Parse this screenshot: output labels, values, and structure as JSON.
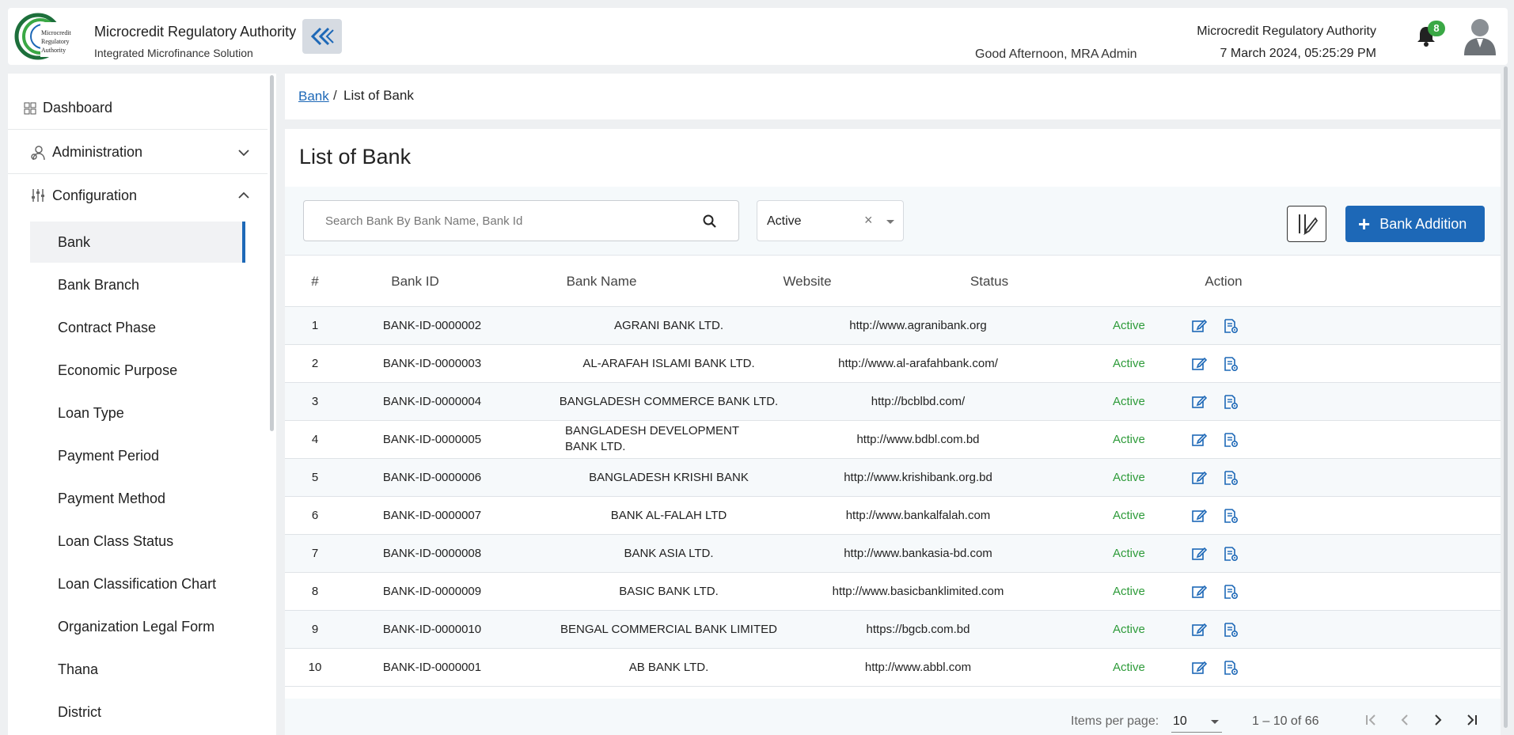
{
  "header": {
    "org_name": "Microcredit Regulatory Authority",
    "org_subtitle": "Integrated Microfinance Solution",
    "logo_text": "Microcredit Regulatory Authority",
    "greeting": "Good Afternoon, MRA Admin",
    "right_org_name": "Microcredit Regulatory Authority",
    "datetime": "7 March 2024, 05:25:29 PM",
    "notification_count": "8",
    "brand_green": "#3aa845",
    "brand_blue": "#1d68b7"
  },
  "sidebar": {
    "dashboard": "Dashboard",
    "administration": "Administration",
    "configuration": "Configuration",
    "config_items": [
      "Bank",
      "Bank Branch",
      "Contract Phase",
      "Economic Purpose",
      "Loan Type",
      "Payment Period",
      "Payment Method",
      "Loan Class Status",
      "Loan Classification Chart",
      "Organization Legal Form",
      "Thana",
      "District"
    ],
    "active_item": "Bank"
  },
  "breadcrumb": {
    "link": "Bank",
    "separator": "/",
    "current": "List of Bank"
  },
  "page": {
    "title": "List of Bank",
    "search_placeholder": "Search Bank By Bank Name, Bank Id",
    "status_filter": "Active",
    "clear_symbol": "×",
    "add_button": "Bank Addition"
  },
  "table": {
    "columns": [
      "#",
      "Bank ID",
      "Bank Name",
      "Website",
      "Status",
      "Action"
    ],
    "rows": [
      {
        "no": "1",
        "id": "BANK-ID-0000002",
        "name": "AGRANI BANK LTD.",
        "website": "http://www.agranibank.org",
        "status": "Active"
      },
      {
        "no": "2",
        "id": "BANK-ID-0000003",
        "name": "AL-ARAFAH ISLAMI BANK LTD.",
        "website": "http://www.al-arafahbank.com/",
        "status": "Active"
      },
      {
        "no": "3",
        "id": "BANK-ID-0000004",
        "name": "BANGLADESH COMMERCE BANK LTD.",
        "website": "http://bcblbd.com/",
        "status": "Active"
      },
      {
        "no": "4",
        "id": "BANK-ID-0000005",
        "name": "BANGLADESH DEVELOPMENT BANK LTD.",
        "website": "http://www.bdbl.com.bd",
        "status": "Active"
      },
      {
        "no": "5",
        "id": "BANK-ID-0000006",
        "name": "BANGLADESH KRISHI BANK",
        "website": "http://www.krishibank.org.bd",
        "status": "Active"
      },
      {
        "no": "6",
        "id": "BANK-ID-0000007",
        "name": "BANK AL-FALAH LTD",
        "website": "http://www.bankalfalah.com",
        "status": "Active"
      },
      {
        "no": "7",
        "id": "BANK-ID-0000008",
        "name": "BANK ASIA LTD.",
        "website": "http://www.bankasia-bd.com",
        "status": "Active"
      },
      {
        "no": "8",
        "id": "BANK-ID-0000009",
        "name": "BASIC BANK LTD.",
        "website": "http://www.basicbanklimited.com",
        "status": "Active"
      },
      {
        "no": "9",
        "id": "BANK-ID-0000010",
        "name": "BENGAL COMMERCIAL BANK LIMITED",
        "website": "https://bgcb.com.bd",
        "status": "Active"
      },
      {
        "no": "10",
        "id": "BANK-ID-0000001",
        "name": "AB BANK LTD.",
        "website": "http://www.abbl.com",
        "status": "Active"
      }
    ],
    "status_color": "#2e9b3a"
  },
  "paginator": {
    "items_per_page_label": "Items per page:",
    "items_per_page": "10",
    "range": "1 – 10 of 66"
  }
}
